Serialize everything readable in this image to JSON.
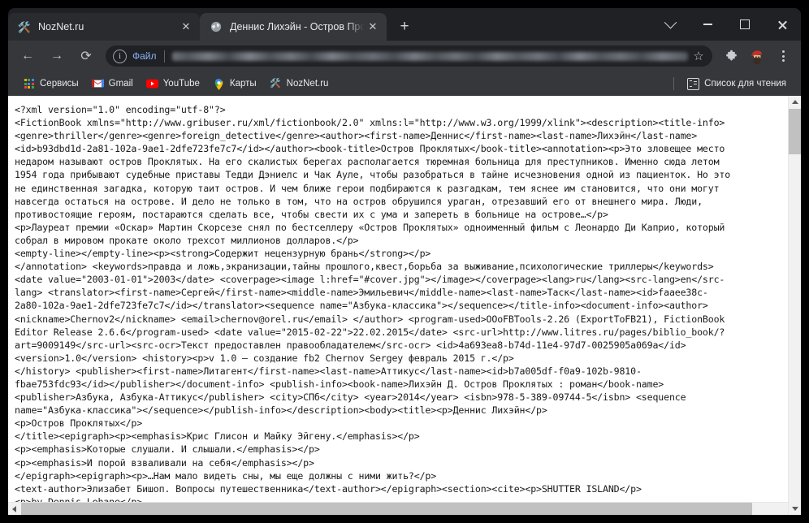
{
  "browser": {
    "tabs": [
      {
        "favicon": "tools-icon",
        "title": "NozNet.ru",
        "active": false,
        "close_label": "✕"
      },
      {
        "favicon": "globe-icon",
        "title": "Деннис Лихэйн - Остров Прокл",
        "active": true,
        "close_label": "✕"
      }
    ],
    "new_tab_label": "+",
    "window_controls": {
      "minimize_to_tray": "chevron-down-icon",
      "minimize": "minimize-icon",
      "maximize": "maximize-icon",
      "close": "close-icon"
    },
    "toolbar": {
      "back": "←",
      "forward": "→",
      "reload": "⟳",
      "scheme_label": "Файл",
      "url_value": "",
      "url_placeholder": "",
      "bookmark_star": "☆",
      "extensions": "puzzle-icon",
      "profile": "avatar-icon",
      "menu": "kebab-menu-icon"
    },
    "bookmarks": [
      {
        "label": "Сервисы",
        "icon": "apps-grid-icon"
      },
      {
        "label": "Gmail",
        "icon": "gmail-icon"
      },
      {
        "label": "YouTube",
        "icon": "youtube-icon"
      },
      {
        "label": "Карты",
        "icon": "maps-pin-icon"
      },
      {
        "label": "NozNet.ru",
        "icon": "tools-icon"
      }
    ],
    "reading_list": {
      "label": "Список для чтения",
      "icon": "reading-list-icon"
    }
  },
  "colors": {
    "chrome_bg": "#202124",
    "toolbar_bg": "#35373a",
    "active_tab_bg": "#35373a",
    "inactive_tab_bg": "#292b2e",
    "link_blue": "#8ab4f8",
    "content_bg": "#ffffff",
    "text_dark": "#1a1a1a",
    "scrollbar_thumb": "#c1c1c1"
  },
  "document": {
    "type": "fb2-xml-source",
    "lines": [
      "<?xml version=\"1.0\" encoding=\"utf-8\"?>",
      "<FictionBook xmlns=\"http://www.gribuser.ru/xml/fictionbook/2.0\" xmlns:l=\"http://www.w3.org/1999/xlink\"><description><title-info>",
      "<genre>thriller</genre><genre>foreign_detective</genre><author><first-name>Деннис</first-name><last-name>Лихэйн</last-name>",
      "<id>b93dbd1d-2a81-102a-9ae1-2dfe723fe7c7</id></author><book-title>Остров Проклятых</book-title><annotation><p>Это зловещее место",
      "недаром называют остров Проклятых. На его скалистых берегах располагается тюремная больница для преступников. Именно сюда летом",
      "1954 года прибывают судебные приставы Тедди Дэниелс и Чак Ауле, чтобы разобраться в тайне исчезновения одной из пациенток. Но это",
      "не единственная загадка, которую таит остров. И чем ближе герои подбираются к разгадкам, тем яснее им становится, что они могут",
      "навсегда остаться на острове. И дело не только в том, что на остров обрушился ураган, отрезавший его от внешнего мира. Люди,",
      "противостоящие героям, постараются сделать все, чтобы свести их с ума и запереть в больнице на острове…</p>",
      "<p>Лауреат премии «Оскар» Мартин Скорсезе снял по бестселлеру «Остров Проклятых» одноименный фильм с Леонардо Ди Каприо, который",
      "собрал в мировом прокате около трехсот миллионов долларов.</p>",
      "<empty-line></empty-line><p><strong>Содержит нецензурную брань</strong></p>",
      "</annotation> <keywords>правда и ложь,экранизации,тайны прошлого,квест,борьба за выживание,психологические триллеры</keywords>",
      "<date value=\"2003-01-01\">2003</date> <coverpage><image l:href=\"#cover.jpg\"></image></coverpage><lang>ru</lang><src-lang>en</src-",
      "lang> <translator><first-name>Сергей</first-name><middle-name>Эмильевич</middle-name><last-name>Таск</last-name><id>faaee38c-",
      "2a80-102a-9ae1-2dfe723fe7c7</id></translator><sequence name=\"Азбука-классика\"></sequence></title-info><document-info><author>",
      "<nickname>Chernov2</nickname> <email>chernov@orel.ru</email> </author> <program-used>OOoFBTools-2.26 (ExportToFB21), FictionBook",
      "Editor Release 2.6.6</program-used> <date value=\"2015-02-22\">22.02.2015</date> <src-url>http://www.litres.ru/pages/biblio_book/?",
      "art=9009149</src-url><src-ocr>Текст предоставлен правообладателем</src-ocr> <id>4a693ea8-b74d-11e4-97d7-0025905a069a</id>",
      "<version>1.0</version> <history><p>v 1.0 — создание fb2 Chernov Sergey февраль 2015 г.</p>",
      "</history> <publisher><first-name>Литагент</first-name><last-name>Аттикус</last-name><id>b7a005df-f0a9-102b-9810-",
      "fbae753fdc93</id></publisher></document-info> <publish-info><book-name>Лихэйн Д. Остров Проклятых : роман</book-name>",
      "<publisher>Азбука, Азбука-Аттикус</publisher> <city>СПб</city> <year>2014</year> <isbn>978-5-389-09744-5</isbn> <sequence",
      "name=\"Азбука-классика\"></sequence></publish-info></description><body><title><p>Деннис Лихэйн</p>",
      "<p>Остров Проклятых</p>",
      "</title><epigraph><p><emphasis>Крис Глисон и Майку Эйгену.</emphasis></p>",
      "<p><emphasis>Которые слушали. И слышали.</emphasis></p>",
      "<p><emphasis>И порой взваливали на себя</emphasis></p>",
      "</epigraph><epigraph><p>…Нам мало видеть сны, мы еще должны с ними жить?</p>",
      "<text-author>Элизабет Бишоп. Вопросы путешественника</text-author></epigraph><section><cite><p>SHUTTER ISLAND</p>",
      "<p>by Dennis Lehane</p>"
    ]
  }
}
